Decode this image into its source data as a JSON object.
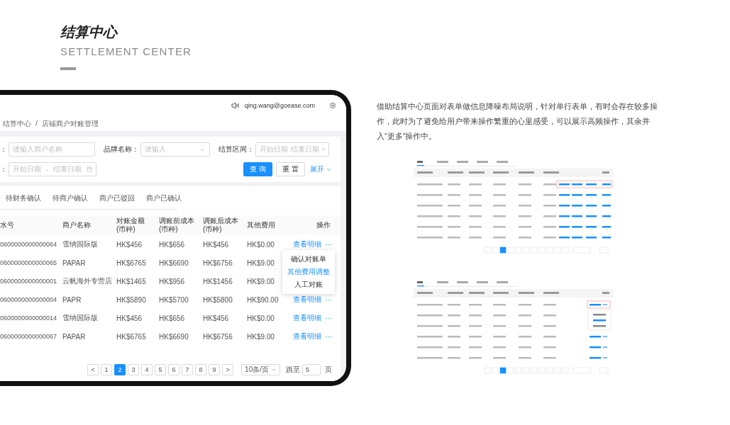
{
  "heading": {
    "title": "结算中心",
    "subtitle": "SETTLEMENT CENTER"
  },
  "device": {
    "header": {
      "user_email": "qing.wang@goease.com"
    },
    "breadcrumb": {
      "items": [
        "结算中心",
        "店铺商户对账管理"
      ],
      "separator": "/"
    },
    "filters": {
      "rows": [
        [
          {
            "label": "：",
            "kind": "input",
            "placeholder": "请输入商户名称"
          },
          {
            "label": "品牌名称：",
            "kind": "select",
            "placeholder": "请输入"
          },
          {
            "label": "结算区间：",
            "kind": "range",
            "start_placeholder": "开始日期",
            "end_placeholder": "结束日期"
          }
        ],
        [
          {
            "label": "：",
            "kind": "range",
            "start_placeholder": "开始日期",
            "separator": "-",
            "end_placeholder": "结束日期"
          }
        ]
      ],
      "buttons": [
        {
          "label": "查 询",
          "kind": "primary"
        },
        {
          "label": "重 置",
          "kind": "default"
        },
        {
          "label": "展开",
          "kind": "link"
        }
      ]
    },
    "tabs": [
      {
        "label": "待财务确认",
        "selected": false
      },
      {
        "label": "待商户确认",
        "selected": false
      },
      {
        "label": "商户已驳回",
        "selected": false
      },
      {
        "label": "商户已确认",
        "selected": false
      }
    ],
    "table": {
      "columns": [
        "水号",
        "商户名称",
        "对账金额(币种)",
        "调账前成本(币种)",
        "调账后成本(币种)",
        "其他费用",
        "操作"
      ],
      "rows": [
        {
          "cells": [
            "0600000000000064",
            "雪纳国际版",
            "HK$456",
            "HK$656",
            "HK$456",
            "HK$0.00"
          ],
          "action": {
            "detail": "查看明细",
            "more": "···"
          },
          "menu": [
            {
              "label": "确认对账单",
              "highlighted": false
            },
            {
              "label": "其他费用调整",
              "highlighted": true
            },
            {
              "label": "人工对账",
              "highlighted": false
            }
          ]
        },
        {
          "cells": [
            "0600000000000065",
            "PAPAR",
            "HK$6765",
            "HK$6690",
            "HK$6756",
            "HK$9.00"
          ]
        },
        {
          "cells": [
            "0600000000000001",
            "云帆海外专营店",
            "HK$1465",
            "HK$956",
            "HK$1456",
            "HK$9.00"
          ]
        },
        {
          "cells": [
            "0600000000000004",
            "PAPR",
            "HK$5890",
            "HK$5700",
            "HK$5800",
            "HK$90.00"
          ],
          "action": {
            "detail": "查看明细",
            "more": "···"
          }
        },
        {
          "cells": [
            "0600000000000014",
            "雪纳国际版",
            "HK$456",
            "HK$656",
            "HK$456",
            "HK$0.00"
          ],
          "action": {
            "detail": "查看明细",
            "more": "···"
          }
        },
        {
          "cells": [
            "0600000000000067",
            "PAPAR",
            "HK$6765",
            "HK$6690",
            "HK$6756",
            "HK$9.00"
          ],
          "action": {
            "detail": "查看明细",
            "more": "···"
          }
        }
      ]
    },
    "pagination": {
      "prev": "<",
      "next": ">",
      "pages": [
        {
          "label": "1",
          "selected": false
        },
        {
          "label": "2",
          "selected": true
        },
        {
          "label": "3",
          "selected": false
        },
        {
          "label": "4",
          "selected": false
        },
        {
          "label": "5",
          "selected": false
        },
        {
          "label": "6",
          "selected": false
        },
        {
          "label": "7",
          "selected": false
        },
        {
          "label": "8",
          "selected": false
        },
        {
          "label": "9",
          "selected": false
        }
      ],
      "page_size": "10条/页",
      "jump_label": "跳至",
      "jump_value": "5",
      "jump_suffix": "页"
    }
  },
  "description": "借助结算中心页面对表单做信息降噪布局说明，针对单行表单，有时会存在较多操作，此时为了避免给用户带来操作繁重的心里感受，可以展示高频操作，其余并入“更多”操作中。",
  "thumbnails": [
    {
      "kind": "inline_actions"
    },
    {
      "kind": "more_menu"
    }
  ]
}
